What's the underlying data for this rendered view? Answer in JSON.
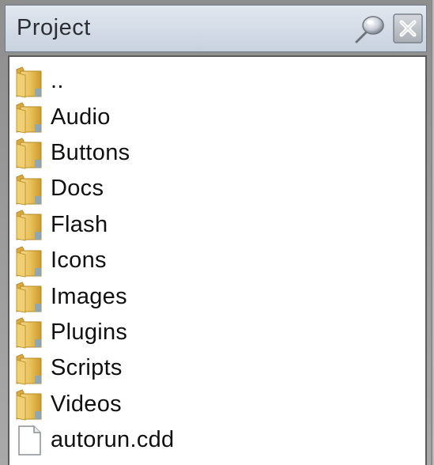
{
  "panel": {
    "title": "Project",
    "pin_button_icon": "pin-icon",
    "close_button_icon": "close-icon"
  },
  "items": [
    {
      "label": "..",
      "type": "folder",
      "icon": "folder-icon"
    },
    {
      "label": "Audio",
      "type": "folder",
      "icon": "folder-icon"
    },
    {
      "label": "Buttons",
      "type": "folder",
      "icon": "folder-icon"
    },
    {
      "label": "Docs",
      "type": "folder",
      "icon": "folder-icon"
    },
    {
      "label": "Flash",
      "type": "folder",
      "icon": "folder-icon"
    },
    {
      "label": "Icons",
      "type": "folder",
      "icon": "folder-icon"
    },
    {
      "label": "Images",
      "type": "folder",
      "icon": "folder-icon"
    },
    {
      "label": "Plugins",
      "type": "folder",
      "icon": "folder-icon"
    },
    {
      "label": "Scripts",
      "type": "folder",
      "icon": "folder-icon"
    },
    {
      "label": "Videos",
      "type": "folder",
      "icon": "folder-icon"
    },
    {
      "label": "autorun.cdd",
      "type": "file",
      "icon": "file-icon"
    }
  ],
  "colors": {
    "titlebar": "#d3dbe6",
    "folder": "#e8c15a",
    "list_background": "#ffffff"
  }
}
